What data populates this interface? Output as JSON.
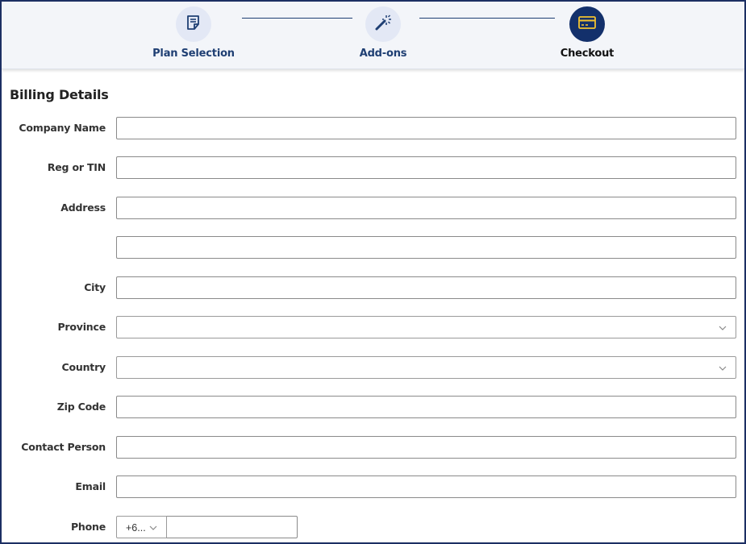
{
  "stepper": {
    "steps": [
      {
        "label": "Plan Selection",
        "icon": "document-icon",
        "state": "completed"
      },
      {
        "label": "Add-ons",
        "icon": "magic-wand-icon",
        "state": "completed"
      },
      {
        "label": "Checkout",
        "icon": "credit-card-icon",
        "state": "active"
      }
    ]
  },
  "form": {
    "title": "Billing Details",
    "company_name": {
      "label": "Company Name",
      "value": ""
    },
    "reg_tin": {
      "label": "Reg or TIN",
      "value": ""
    },
    "address": {
      "label": "Address",
      "line1": "",
      "line2": ""
    },
    "city": {
      "label": "City",
      "value": ""
    },
    "province": {
      "label": "Province",
      "value": ""
    },
    "country": {
      "label": "Country",
      "value": ""
    },
    "zip_code": {
      "label": "Zip Code",
      "value": ""
    },
    "contact_person": {
      "label": "Contact Person",
      "value": ""
    },
    "email": {
      "label": "Email",
      "value": ""
    },
    "phone": {
      "label": "Phone",
      "country_code": "+6...",
      "number": ""
    }
  },
  "colors": {
    "primary": "#13306b",
    "step_light": "#e3e8f5",
    "card_accent": "#f2c230",
    "frame_border": "#1c2f63"
  }
}
